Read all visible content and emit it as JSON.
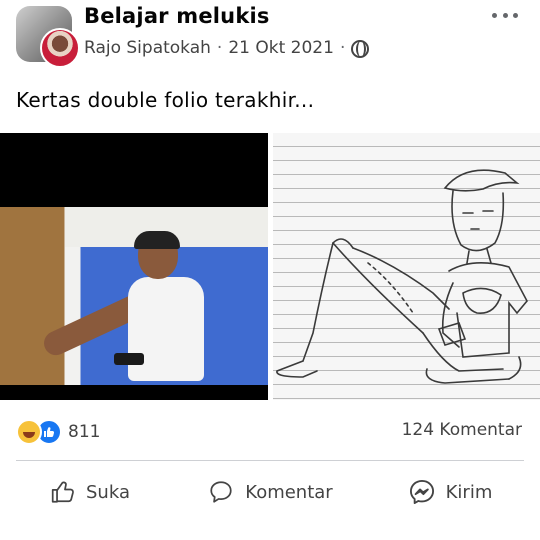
{
  "header": {
    "group_name": "Belajar melukis",
    "author": "Rajo Sipatokah",
    "separator": "·",
    "date": "21 Okt 2021",
    "privacy_icon": "group-icon",
    "menu_icon": "more-options-icon"
  },
  "post": {
    "text": "Kertas double folio terakhir..."
  },
  "media": {
    "left_image": "photo of young man in cap and white t-shirt sitting against blue wall holding phone",
    "right_image": "pencil sketch of same pose on lined paper"
  },
  "stats": {
    "reaction_icons": [
      "haha-icon",
      "like-icon"
    ],
    "reaction_count": "811",
    "comment_count": "124 Komentar"
  },
  "actions": [
    {
      "label": "Suka",
      "icon": "thumbs-up-icon"
    },
    {
      "label": "Komentar",
      "icon": "comment-icon"
    },
    {
      "label": "Kirim",
      "icon": "messenger-icon"
    }
  ],
  "colors": {
    "accent": "#1877f2",
    "text": "#050505",
    "secondary_text": "#444444"
  }
}
